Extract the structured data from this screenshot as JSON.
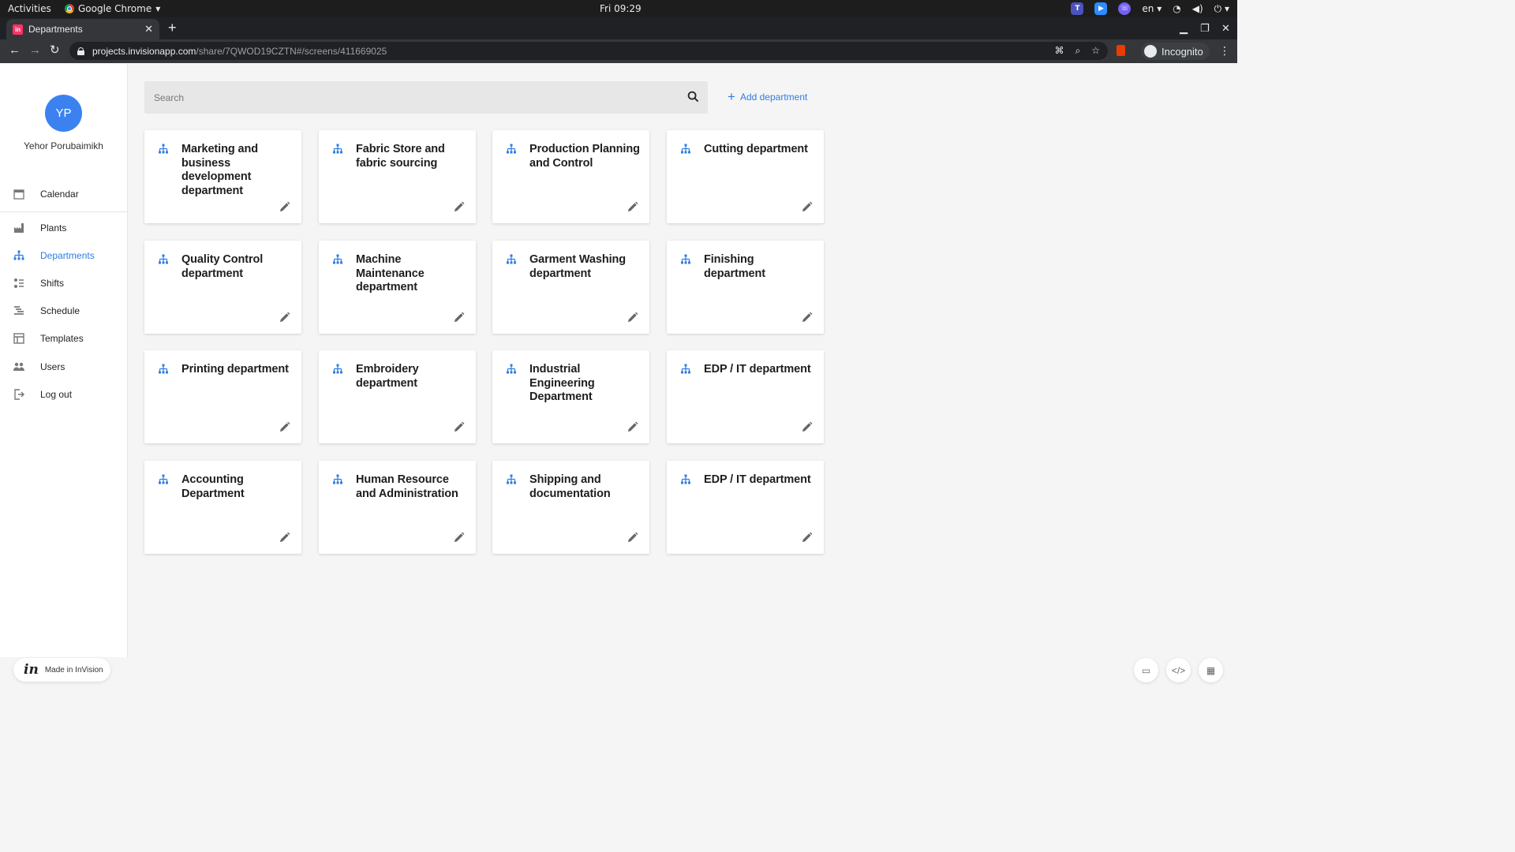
{
  "system": {
    "activities": "Activities",
    "app_menu": "Google Chrome",
    "clock": "Fri 09:29",
    "lang": "en"
  },
  "browser": {
    "tab_title": "Departments",
    "url_host": "projects.invisionapp.com",
    "url_path": "/share/7QWOD19CZTN#/screens/411669025",
    "incognito_label": "Incognito"
  },
  "user": {
    "initials": "YP",
    "name": "Yehor Porubaimikh"
  },
  "nav": {
    "calendar": "Calendar",
    "plants": "Plants",
    "departments": "Departments",
    "shifts": "Shifts",
    "schedule": "Schedule",
    "templates": "Templates",
    "users": "Users",
    "logout": "Log out"
  },
  "toolbar": {
    "search_placeholder": "Search",
    "add_department": "Add department"
  },
  "departments": [
    "Marketing and business development department",
    "Fabric Store and fabric sourcing",
    "Production Planning and Control",
    "Cutting department",
    "Quality Control department",
    "Machine Maintenance department",
    "Garment Washing department",
    "Finishing department",
    "Printing department",
    "Embroidery department",
    "Industrial Engineering Department",
    "EDP / IT department",
    "Accounting Department",
    "Human Resource and Administration",
    "Shipping and documentation",
    "EDP / IT department"
  ],
  "footer": {
    "made_in": "Made in InVision"
  },
  "colors": {
    "accent": "#2f7de1",
    "avatar": "#3b82f0"
  }
}
